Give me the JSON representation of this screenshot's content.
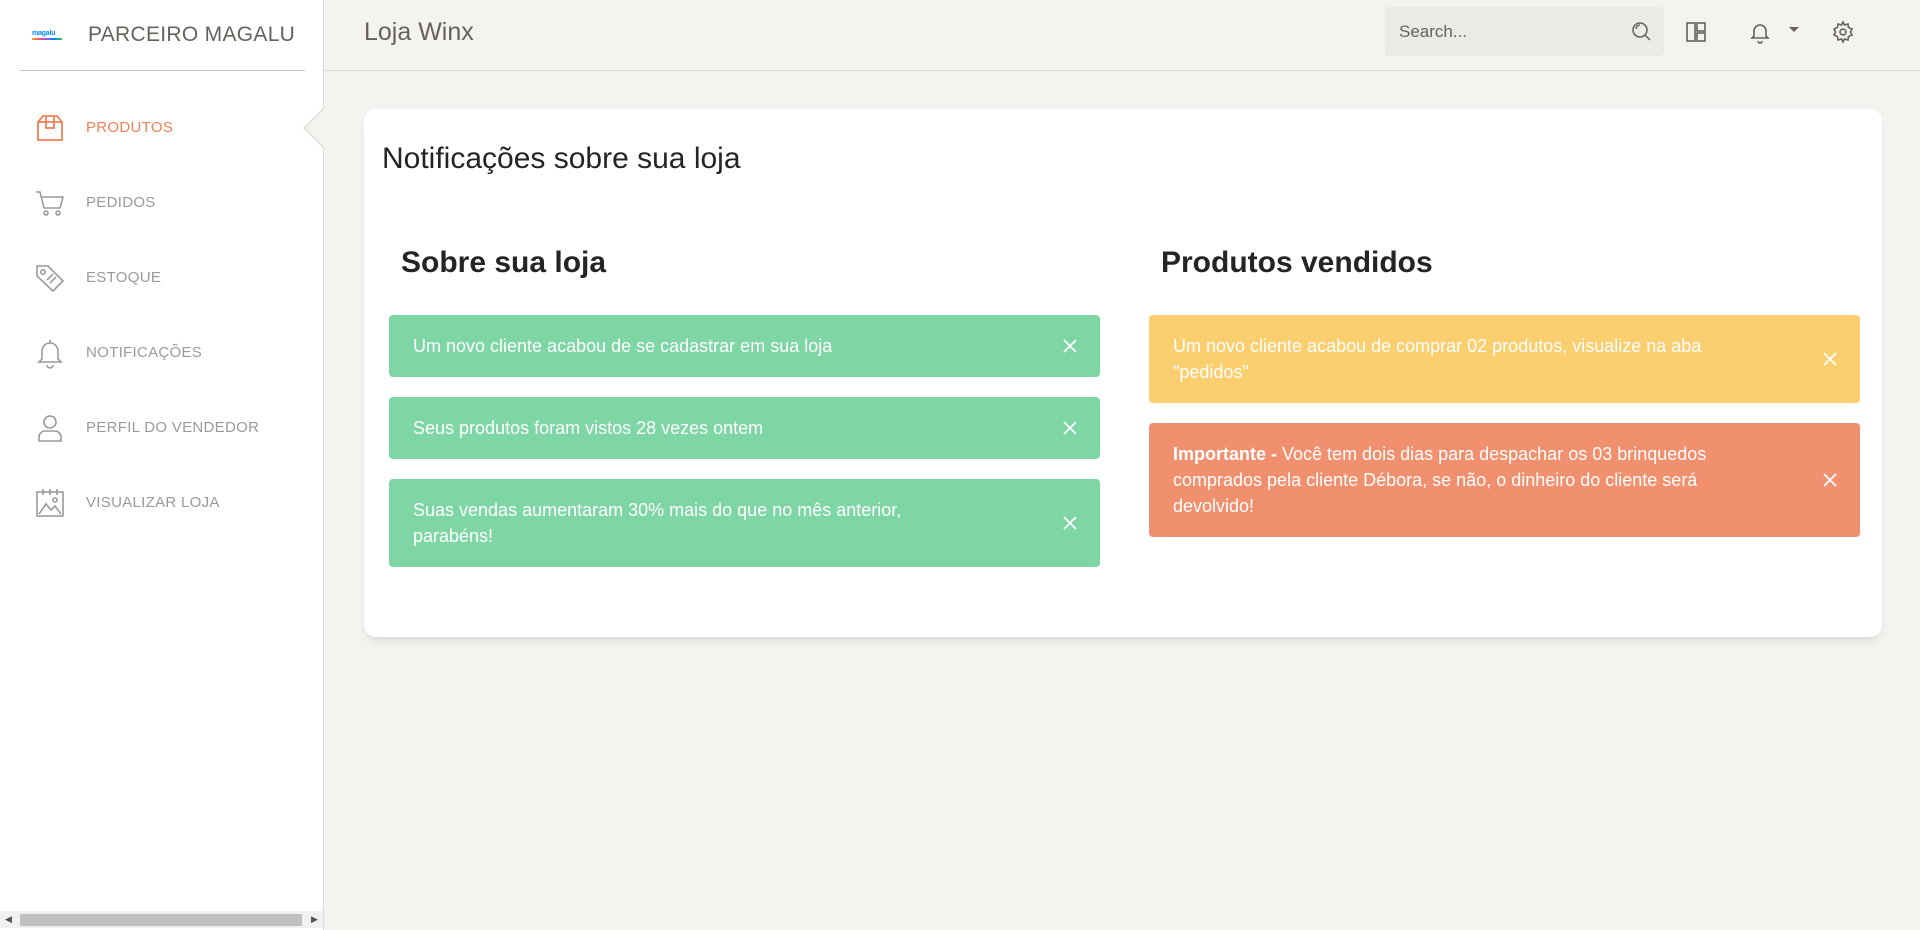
{
  "sidebar": {
    "brand_logo_text": "magalu",
    "brand_name": "PARCEIRO MAGALU",
    "items": [
      {
        "label": "PRODUTOS",
        "icon": "box-icon",
        "active": true
      },
      {
        "label": "PEDIDOS",
        "icon": "cart-icon",
        "active": false
      },
      {
        "label": "ESTOQUE",
        "icon": "tag-icon",
        "active": false
      },
      {
        "label": "NOTIFICAÇÕES",
        "icon": "bell-icon",
        "active": false
      },
      {
        "label": "PERFIL DO VENDEDOR",
        "icon": "user-icon",
        "active": false
      },
      {
        "label": "VISUALIZAR LOJA",
        "icon": "image-calendar-icon",
        "active": false
      }
    ]
  },
  "topbar": {
    "title": "Loja Winx",
    "search_placeholder": "Search...",
    "icons": [
      "search-icon",
      "dashboard-icon",
      "bell-icon",
      "gear-icon"
    ]
  },
  "card": {
    "title": "Notificações sobre sua loja",
    "left_column": {
      "title": "Sobre sua loja",
      "alerts": [
        {
          "type": "success",
          "text": "Um novo cliente acabou de se cadastrar em sua loja"
        },
        {
          "type": "success",
          "text": "Seus produtos foram vistos 28 vezes ontem"
        },
        {
          "type": "success",
          "text": "Suas vendas aumentaram 30% mais do que no mês anterior, parabéns!"
        }
      ]
    },
    "right_column": {
      "title": "Produtos vendidos",
      "alerts": [
        {
          "type": "warning",
          "text": "Um novo cliente acabou de comprar 02 produtos, visualize na aba \"pedidos\""
        },
        {
          "type": "danger",
          "strong": "Importante - ",
          "text": "Você tem dois dias para despachar os 03 brinquedos comprados pela cliente Débora, se não, o dinheiro do cliente será devolvido!"
        }
      ]
    }
  },
  "colors": {
    "accent": "#ef8157",
    "success": "#7ed6a5",
    "warning": "#fbcf6f",
    "danger": "#f0906e",
    "background": "#f4f3ef"
  }
}
